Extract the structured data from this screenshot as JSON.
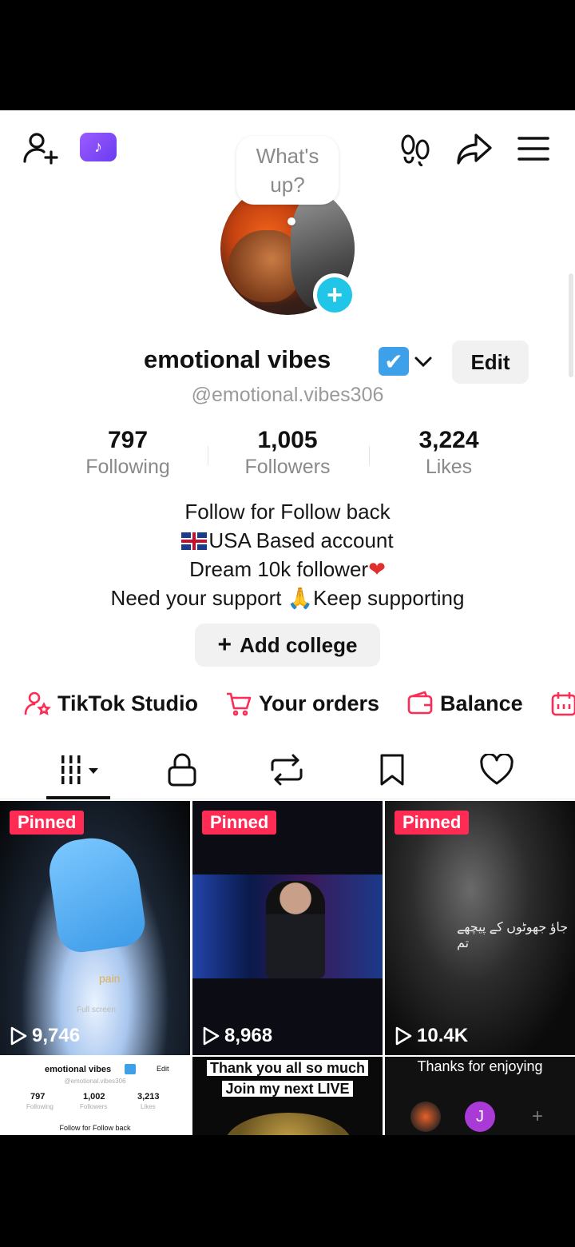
{
  "topbar": {
    "bubble_text": "What's up?"
  },
  "profile": {
    "name": "emotional vibes",
    "handle": "@emotional.vibes306",
    "edit_label": "Edit",
    "stats": [
      {
        "value": "797",
        "label": "Following"
      },
      {
        "value": "1,005",
        "label": "Followers"
      },
      {
        "value": "3,224",
        "label": "Likes"
      }
    ],
    "bio": {
      "line1": "Follow for Follow back",
      "line2": "USA Based account",
      "line3": "Dream 10k follower",
      "line4a": "Need your support ",
      "line4b": "Keep supporting"
    },
    "add_college_label": "Add college"
  },
  "shortcuts": [
    {
      "label": "TikTok Studio",
      "icon": "person-star-icon"
    },
    {
      "label": "Your orders",
      "icon": "cart-icon"
    },
    {
      "label": "Balance",
      "icon": "wallet-icon"
    }
  ],
  "tabs": [
    "videos-grid-icon",
    "lock-icon",
    "repost-icon",
    "bookmark-icon",
    "heart-icon"
  ],
  "grid": {
    "pinned_label": "Pinned",
    "tiles": [
      {
        "views": "9,746"
      },
      {
        "views": "8,968"
      },
      {
        "views": "10.4K"
      }
    ],
    "tile1_caption": "pain",
    "tile1_small": "Full screen",
    "tile3_urdu": "جاؤ جھوٹوں کے پیچھے تم",
    "bottom": {
      "mini_name": "emotional vibes",
      "mini_edit": "Edit",
      "mini_handle": "@emotional.vibes306",
      "mini_stats": [
        {
          "value": "797",
          "label": "Following"
        },
        {
          "value": "1,002",
          "label": "Followers"
        },
        {
          "value": "3,213",
          "label": "Likes"
        }
      ],
      "mini_bio": "Follow for Follow back",
      "live_line1": "Thank you all so much",
      "live_line2": "Join my next LIVE",
      "thanks_text": "Thanks for enjoying",
      "j_avatar": "J"
    }
  },
  "colors": {
    "accent": "#fe2c55",
    "plus_badge": "#20c5e8",
    "verified": "#3fa0ea"
  }
}
